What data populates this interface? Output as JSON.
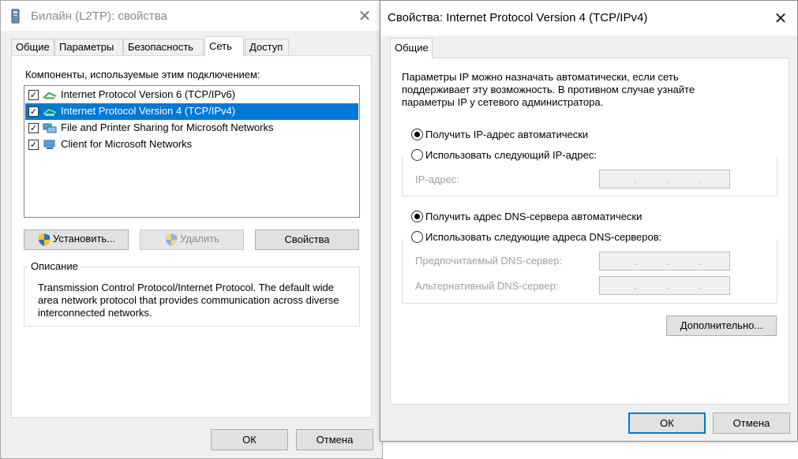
{
  "left_window": {
    "title": "Билайн (L2TP): свойства",
    "tabs": [
      {
        "label": "Общие",
        "active": false
      },
      {
        "label": "Параметры",
        "active": false
      },
      {
        "label": "Безопасность",
        "active": false
      },
      {
        "label": "Сеть",
        "active": true
      },
      {
        "label": "Доступ",
        "active": false
      }
    ],
    "components_label": "Компоненты, используемые этим подключением:",
    "components": [
      {
        "label": "Internet Protocol Version 6 (TCP/IPv6)",
        "checked": true,
        "selected": false,
        "icon": "network-protocol-icon"
      },
      {
        "label": "Internet Protocol Version 4 (TCP/IPv4)",
        "checked": true,
        "selected": true,
        "icon": "network-protocol-icon"
      },
      {
        "label": "File and Printer Sharing for Microsoft Networks",
        "checked": true,
        "selected": false,
        "icon": "network-service-icon"
      },
      {
        "label": "Client for Microsoft Networks",
        "checked": true,
        "selected": false,
        "icon": "network-client-icon"
      }
    ],
    "buttons": {
      "install": "Установить...",
      "remove": "Удалить",
      "properties": "Свойства"
    },
    "description": {
      "title": "Описание",
      "text": "Transmission Control Protocol/Internet Protocol. The default wide area network protocol that provides communication across diverse interconnected networks."
    },
    "footer": {
      "ok": "ОК",
      "cancel": "Отмена"
    }
  },
  "right_window": {
    "title": "Свойства: Internet Protocol Version 4 (TCP/IPv4)",
    "tabs": [
      {
        "label": "Общие",
        "active": true
      }
    ],
    "intro": "Параметры IP можно назначать автоматически, если сеть поддерживает эту возможность. В противном случае узнайте параметры IP у сетевого администратора.",
    "ip_auto": {
      "label": "Получить IP-адрес автоматически",
      "selected": true
    },
    "ip_manual": {
      "label": "Использовать следующий IP-адрес:",
      "selected": false
    },
    "ip_address_label": "IP-адрес:",
    "dns_auto": {
      "label": "Получить адрес DNS-сервера автоматически",
      "selected": true
    },
    "dns_manual": {
      "label": "Использовать следующие адреса DNS-серверов:",
      "selected": false
    },
    "preferred_dns_label": "Предпочитаемый DNS-сервер:",
    "alternate_dns_label": "Альтернативный DNS-сервер:",
    "advanced_button": "Дополнительно...",
    "footer": {
      "ok": "ОК",
      "cancel": "Отмена"
    }
  },
  "colors": {
    "selection": "#0078d7",
    "dialog_bg": "#f0f0f0",
    "disabled_text": "#a0a0a0"
  }
}
